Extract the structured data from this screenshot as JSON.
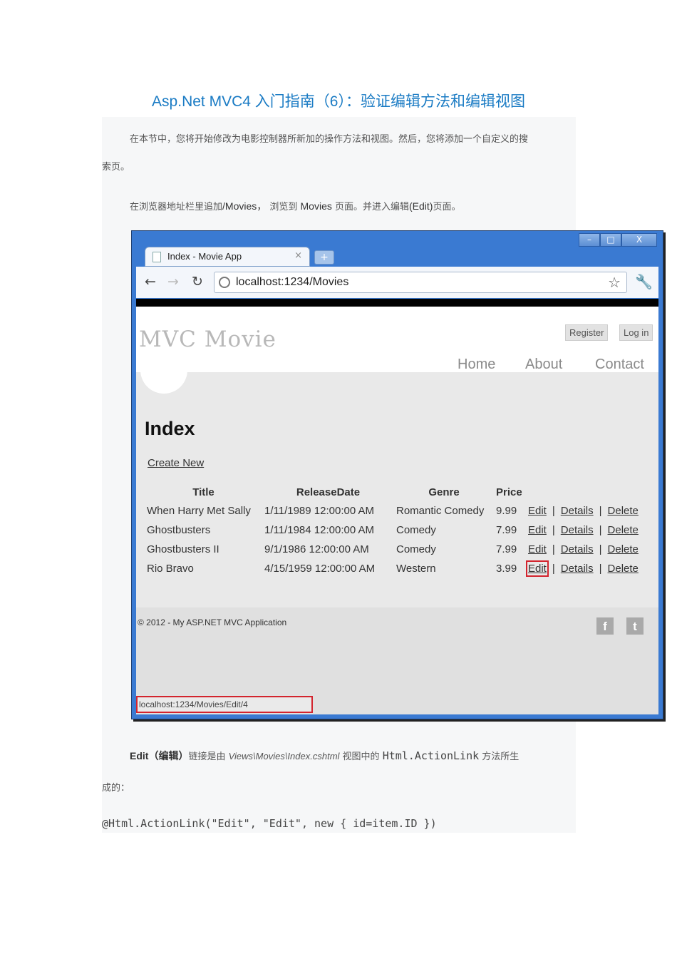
{
  "document": {
    "title": "Asp.Net MVC4 入门指南（6）：验证编辑方法和编辑视图",
    "para1_line1": "在本节中，您将开始修改为电影控制器所新加的操作方法和视图。然后，您将添加一个自定义的搜",
    "para1_line2": "索页。",
    "para2_a": "在浏览器地址栏里追加",
    "para2_b": "/Movies，",
    "para2_c": " 浏览到 ",
    "para2_d": "Movies",
    "para2_e": " 页面。并进入编辑",
    "para2_f": "(Edit)",
    "para2_g": "页面。",
    "para3_a": "Edit（编辑）",
    "para3_b": "链接是由 ",
    "para3_c": "Views\\Movies\\Index.cshtml",
    "para3_d": " 视图中的 ",
    "para3_e": "Html.ActionLink",
    "para3_f": " 方法所生",
    "para3_line2": "成的：",
    "code": "@Html.ActionLink(\"Edit\", \"Edit\", new { id=item.ID })"
  },
  "browser": {
    "tab_title": "Index - Movie App",
    "tab_close": "×",
    "new_tab": "+",
    "win_min": "–",
    "win_max": "□",
    "win_close": "X",
    "url": "localhost:1234/Movies",
    "status_url": "localhost:1234/Movies/Edit/4"
  },
  "site": {
    "logo": "MVC Movie",
    "register": "Register",
    "login": "Log in",
    "nav": [
      "Home",
      "About",
      "Contact"
    ],
    "heading": "Index",
    "create_new": "Create New",
    "columns": [
      "Title",
      "ReleaseDate",
      "Genre",
      "Price"
    ],
    "movies": [
      {
        "title": "When Harry Met Sally",
        "date": "1/11/1989 12:00:00 AM",
        "genre": "Romantic Comedy",
        "price": "9.99"
      },
      {
        "title": "Ghostbusters",
        "date": "1/11/1984 12:00:00 AM",
        "genre": "Comedy",
        "price": "7.99"
      },
      {
        "title": "Ghostbusters II",
        "date": "9/1/1986 12:00:00 AM",
        "genre": "Comedy",
        "price": "7.99"
      },
      {
        "title": "Rio Bravo",
        "date": "4/15/1959 12:00:00 AM",
        "genre": "Western",
        "price": "3.99"
      }
    ],
    "actions": {
      "edit": "Edit",
      "details": "Details",
      "delete": "Delete",
      "sep": "|"
    },
    "copyright": "© 2012 - My ASP.NET MVC Application",
    "facebook": "f",
    "twitter": "t"
  },
  "colors": {
    "title_blue": "#1a7bc4",
    "highlight_red": "#d3242e",
    "window_blue": "#3a7ad2"
  }
}
